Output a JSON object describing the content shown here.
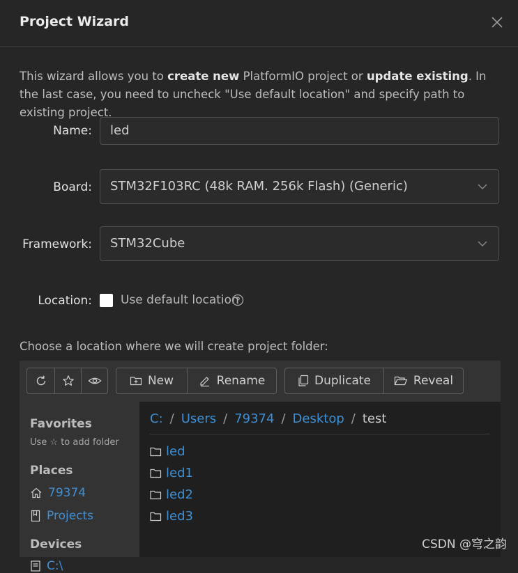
{
  "dialog": {
    "title": "Project Wizard"
  },
  "intro": {
    "t1": "This wizard allows you to ",
    "b1": "create new",
    "t2": " PlatformIO project or ",
    "b2": "update existing",
    "t3": ". In the last case, you need to uncheck \"Use default location\" and specify path to existing project."
  },
  "form": {
    "name_label": "Name",
    "name_value": "led",
    "board_label": "Board",
    "board_value": "STM32F103RC (48k RAM. 256k Flash) (Generic)",
    "framework_label": "Framework",
    "framework_value": "STM32Cube",
    "location_label": "Location",
    "use_default_label": "Use default location",
    "use_default_checked": false
  },
  "browser": {
    "choose_text": "Choose a location where we will create project folder:",
    "toolbar": {
      "new": "New",
      "rename": "Rename",
      "duplicate": "Duplicate",
      "reveal": "Reveal"
    },
    "sidebar": {
      "favorites_title": "Favorites",
      "favorites_hint": "Use ☆ to add folder",
      "places_title": "Places",
      "places": [
        "79374",
        "Projects"
      ],
      "devices_title": "Devices",
      "devices": [
        "C:\\"
      ]
    },
    "breadcrumb": {
      "links": [
        "C:",
        "Users",
        "79374",
        "Desktop"
      ],
      "current": "test",
      "separator": "/"
    },
    "folders": [
      "led",
      "led1",
      "led2",
      "led3"
    ]
  },
  "watermark": "CSDN @穹之韵",
  "colors": {
    "accent": "#3f8fd2",
    "background": "#262626",
    "panel": "#333333"
  }
}
